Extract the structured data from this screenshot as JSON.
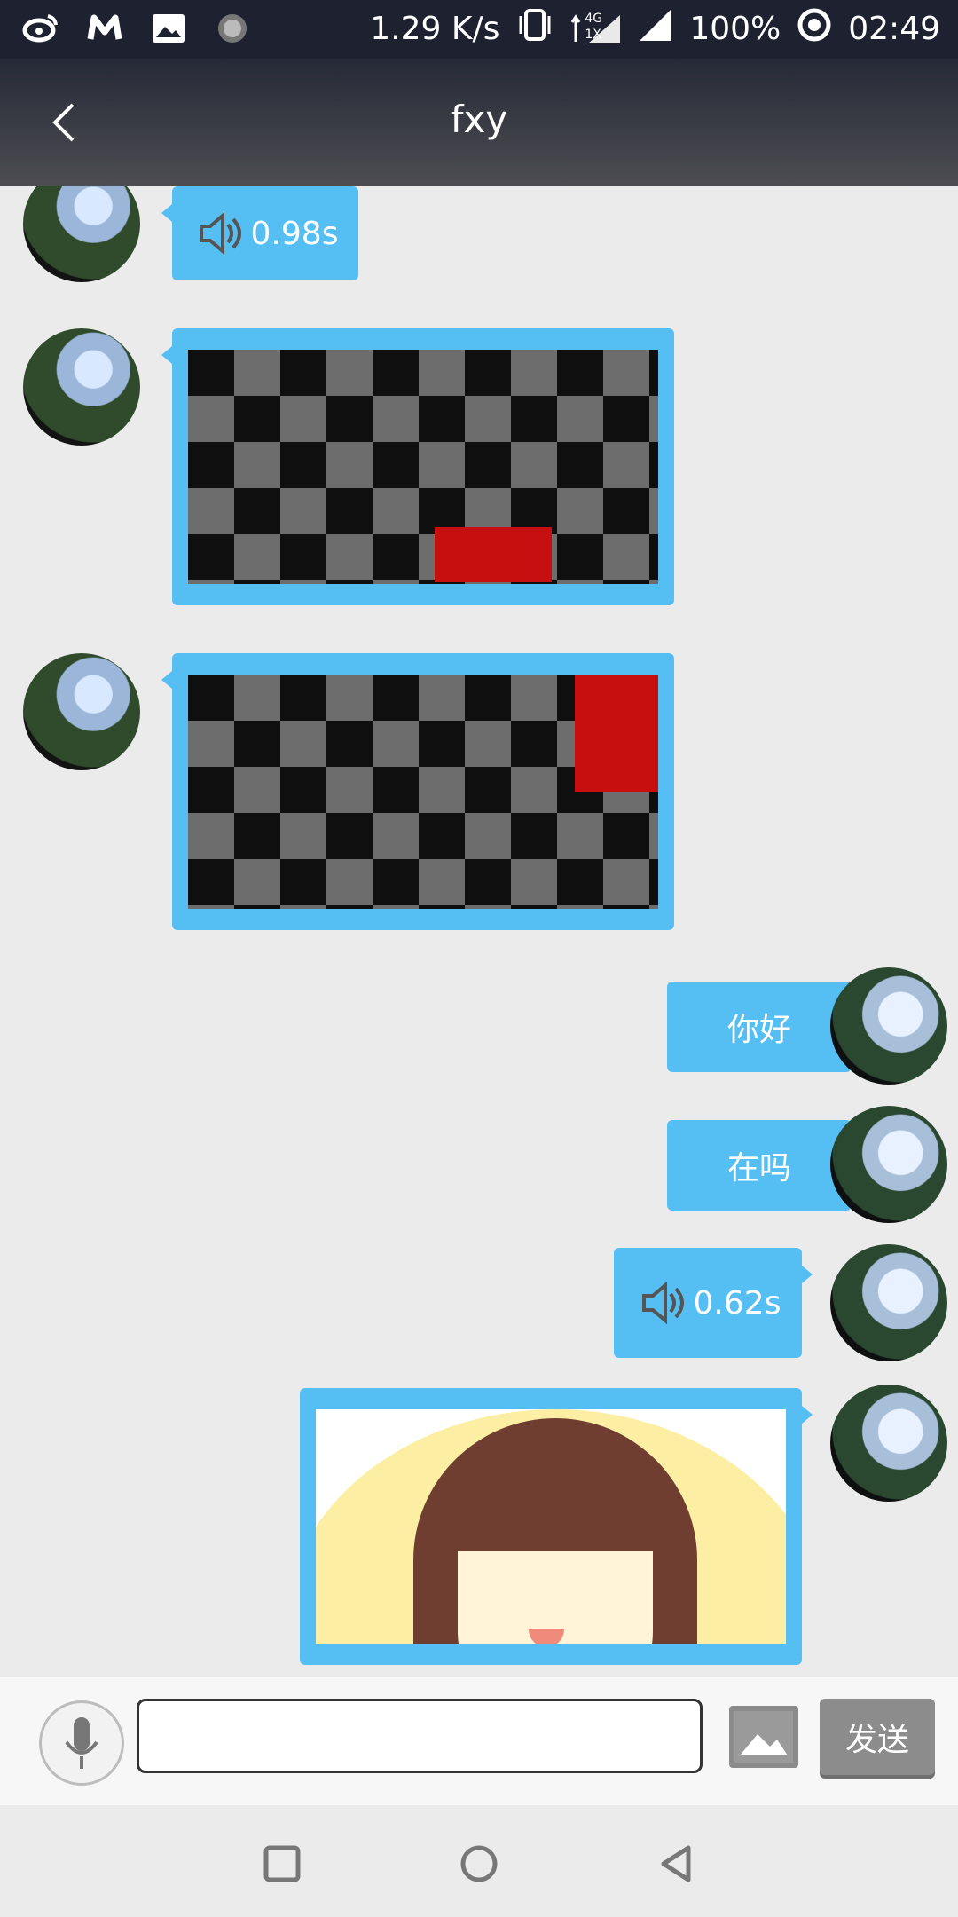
{
  "status_bar": {
    "network_speed": "1.29 K/s",
    "signal_label_4g": "4G",
    "signal_label_1x": "1X",
    "battery": "100%",
    "time": "02:49",
    "left_icons": [
      "weibo-icon",
      "m-icon",
      "image-icon",
      "loading-icon"
    ]
  },
  "header": {
    "title": "fxy"
  },
  "messages": [
    {
      "side": "left",
      "type": "voice",
      "duration": "0.98s"
    },
    {
      "side": "left",
      "type": "image",
      "image": "checkerboard",
      "accent": "#c70f10"
    },
    {
      "side": "left",
      "type": "image",
      "image": "checkerboard",
      "accent": "#c70f10"
    },
    {
      "side": "right",
      "type": "text",
      "text": "你好"
    },
    {
      "side": "right",
      "type": "text",
      "text": "在吗"
    },
    {
      "side": "right",
      "type": "voice",
      "duration": "0.62s"
    },
    {
      "side": "right",
      "type": "image",
      "image": "girl-illustration"
    }
  ],
  "input_bar": {
    "input_value": "",
    "placeholder": "",
    "send_label": "发送"
  },
  "nav_bar": {
    "buttons": [
      "recent-apps",
      "home",
      "back"
    ]
  },
  "colors": {
    "bubble": "#55bff4",
    "header_top": "#262a37",
    "background": "#ebebeb"
  }
}
